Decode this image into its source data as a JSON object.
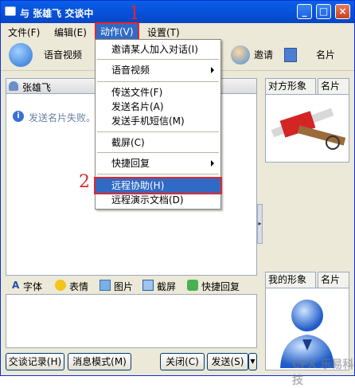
{
  "window": {
    "title": "与 张雄飞 交谈中"
  },
  "titlebar_buttons": [
    "_",
    "□",
    "×"
  ],
  "menubar": {
    "items": [
      "文件(F)",
      "编辑(E)",
      "动作(V)",
      "设置(T)"
    ]
  },
  "toolbar": {
    "voice_video": "语音视频",
    "invite": "邀请",
    "card": "名片"
  },
  "chat": {
    "contact_name": "张雄飞",
    "message": "发送名片失败。"
  },
  "format_bar": {
    "font": "字体",
    "emoticon": "表情",
    "picture": "图片",
    "screenshot": "截屏",
    "quick_reply": "快捷回复"
  },
  "bottom_buttons": {
    "history": "交谈记录(H)",
    "message_mode": "消息模式(M)",
    "close": "关闭(C)",
    "send": "发送(S)"
  },
  "right_panel": {
    "peer_tab": "对方形象",
    "peer_card_tab": "名片",
    "my_tab": "我的形象",
    "my_card_tab": "名片"
  },
  "dropdown": {
    "items": [
      "邀请某人加入对话(I)",
      "语音视频",
      "传送文件(F)",
      "发送名片(A)",
      "发送手机短信(M)",
      "截屏(C)",
      "快捷回复",
      "远程协助(H)",
      "远程演示文档(D)"
    ]
  },
  "annotations": {
    "step1": "1",
    "step2": "2"
  },
  "watermark": "CFX 乐易科技",
  "colors": {
    "accent": "#316AC5",
    "highlight_box": "#E3262B",
    "titlebar": "#0854DD"
  }
}
